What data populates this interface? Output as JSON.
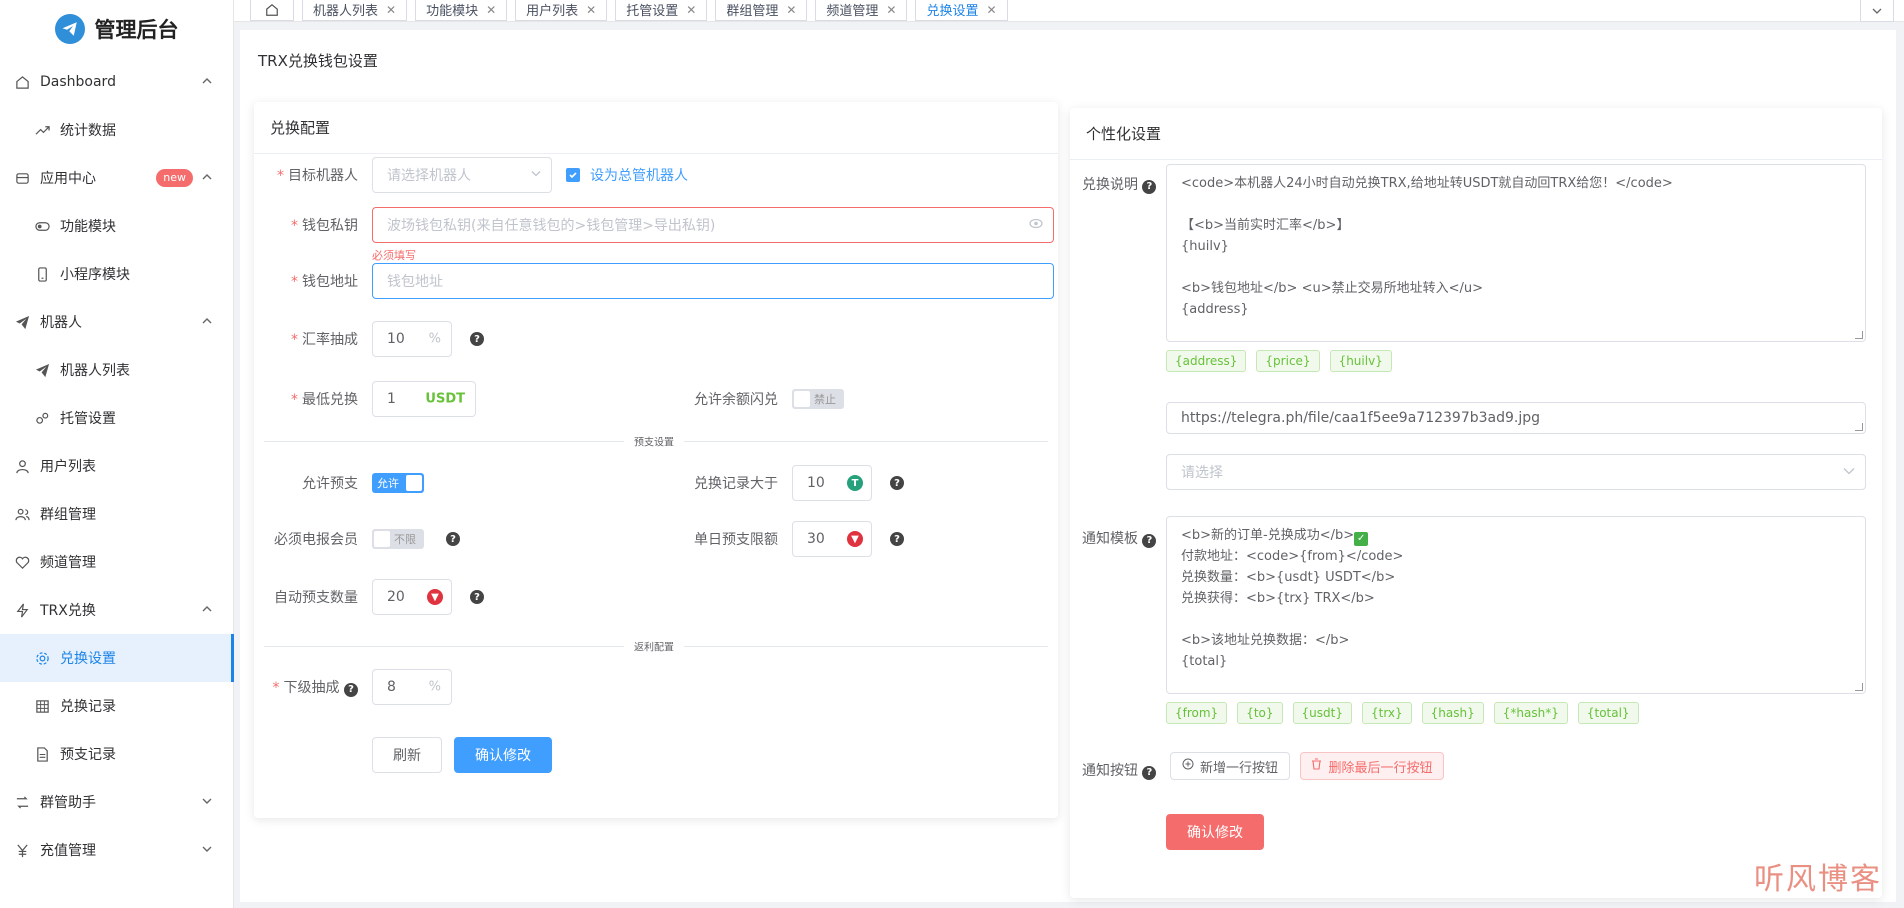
{
  "app": {
    "title": "管理后台"
  },
  "sidebar": {
    "items": [
      {
        "label": "Dashboard",
        "icon": "home-icon",
        "expanded": true
      },
      {
        "label": "统计数据",
        "icon": "trend-icon",
        "sub": true
      },
      {
        "label": "应用中心",
        "icon": "app-icon",
        "badge": "new",
        "expanded": true
      },
      {
        "label": "功能模块",
        "icon": "toggle-icon",
        "sub": true
      },
      {
        "label": "小程序模块",
        "icon": "phone-icon",
        "sub": true
      },
      {
        "label": "机器人",
        "icon": "send-icon",
        "expanded": true
      },
      {
        "label": "机器人列表",
        "icon": "send-icon",
        "sub": true
      },
      {
        "label": "托管设置",
        "icon": "gears-icon",
        "sub": true
      },
      {
        "label": "用户列表",
        "icon": "user-icon"
      },
      {
        "label": "群组管理",
        "icon": "group-icon"
      },
      {
        "label": "频道管理",
        "icon": "heart-icon"
      },
      {
        "label": "TRX兑换",
        "icon": "bolt-icon",
        "expanded": true
      },
      {
        "label": "兑换设置",
        "icon": "cog-icon",
        "sub": true,
        "active": true
      },
      {
        "label": "兑换记录",
        "icon": "grid-icon",
        "sub": true
      },
      {
        "label": "预支记录",
        "icon": "doc-icon",
        "sub": true
      },
      {
        "label": "群管助手",
        "icon": "switch-icon",
        "collapsed": true
      },
      {
        "label": "充值管理",
        "icon": "yen-icon",
        "collapsed": true
      }
    ]
  },
  "tabs": [
    {
      "label": "机器人列表"
    },
    {
      "label": "功能模块"
    },
    {
      "label": "用户列表"
    },
    {
      "label": "托管设置"
    },
    {
      "label": "群组管理"
    },
    {
      "label": "频道管理"
    },
    {
      "label": "兑换设置",
      "active": true
    }
  ],
  "page": {
    "title": "TRX兑换钱包设置"
  },
  "exchange": {
    "header": "兑换配置",
    "target_robot": {
      "label": "目标机器人",
      "placeholder": "请选择机器人"
    },
    "master_robot_checkbox": "设为总管机器人",
    "private_key": {
      "label": "钱包私钥",
      "placeholder": "波场钱包私钥(来自任意钱包的>钱包管理>导出私钥)",
      "error": "必须填写"
    },
    "address": {
      "label": "钱包地址",
      "placeholder": "钱包地址"
    },
    "rate": {
      "label": "汇率抽成",
      "value": "10",
      "suffix": "%"
    },
    "min_exchange": {
      "label": "最低兑换",
      "value": "1",
      "suffix": "USDT"
    },
    "allow_balance_flash": {
      "label": "允许余额闪兑",
      "state": "禁止"
    },
    "divider_advance": "预支设置",
    "allow_advance": {
      "label": "允许预支",
      "state": "允许"
    },
    "exchange_record_gt": {
      "label": "兑换记录大于",
      "value": "10"
    },
    "require_premium": {
      "label": "必须电报会员",
      "state": "不限"
    },
    "daily_limit": {
      "label": "单日预支限额",
      "value": "30"
    },
    "auto_advance": {
      "label": "自动预支数量",
      "value": "20"
    },
    "divider_referral": "返利配置",
    "sub_commission": {
      "label": "下级抽成",
      "value": "8",
      "suffix": "%"
    },
    "refresh_btn": "刷新",
    "confirm_btn": "确认修改"
  },
  "personal": {
    "header": "个性化设置",
    "desc_label": "兑换说明",
    "desc_lines": [
      "<code>本机器人24小时自动兑换TRX,给地址转USDT就自动回TRX给您！</code>",
      "",
      "【<b>当前实时汇率</b>】",
      "{huilv}",
      "",
      "<b>钱包地址</b> <u>禁止交易所地址转入</u>",
      "{address}"
    ],
    "desc_tags": [
      "{address}",
      "{price}",
      "{huilv}"
    ],
    "image_url": "https://telegra.ph/file/caa1f5ee9a712397b3ad9.jpg",
    "select_placeholder": "请选择",
    "notify_label": "通知模板",
    "notify_lines": [
      "<b>新的订单-兑换成功</b>",
      "付款地址：<code>{from}</code>",
      "兑换数量：<b>{usdt} USDT</b>",
      "兑换获得：<b>{trx} TRX</b>",
      "",
      "<b>该地址兑换数据：</b>",
      "{total}"
    ],
    "notify_tags": [
      "{from}",
      "{to}",
      "{usdt}",
      "{trx}",
      "{hash}",
      "{*hash*}",
      "{total}"
    ],
    "button_label": "通知按钮",
    "add_row_btn": "新增一行按钮",
    "delete_row_btn": "删除最后一行按钮",
    "confirm_btn": "确认修改"
  },
  "watermark": "听风博客",
  "colors": {
    "primary": "#409eff",
    "danger": "#f56c6c",
    "success": "#67c23a",
    "sidebar_active": "#1c84e8"
  }
}
